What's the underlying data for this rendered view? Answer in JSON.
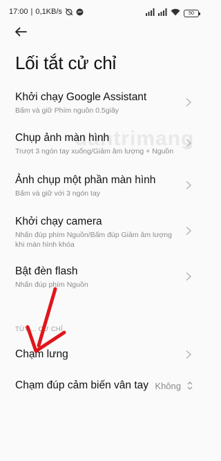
{
  "status_bar": {
    "time": "17:00",
    "network_speed": "0,1KB/s",
    "battery_level": "50",
    "icons": [
      "alarm-off-icon",
      "messenger-icon",
      "signal-icon",
      "signal-icon",
      "wifi-icon",
      "battery-icon"
    ]
  },
  "header": {
    "back_icon": "arrow-left-icon",
    "title": "Lối tắt cử chỉ"
  },
  "items": [
    {
      "title": "Khởi chạy Google Assistant",
      "subtitle": "Bấm và giữ Phím nguồn 0.5giây"
    },
    {
      "title": "Chụp ảnh màn hình",
      "subtitle": "Trượt 3 ngón tay xuống/Giảm âm lượng + Nguồn"
    },
    {
      "title": "Ảnh chụp một phần màn hình",
      "subtitle": "Bấm và giữ với 3 ngón tay"
    },
    {
      "title": "Khởi chạy camera",
      "subtitle_line1": "Nhấn đúp phím Nguồn/Bấm đúp Giảm âm lượng",
      "subtitle_line2": "khi màn hình khóa"
    },
    {
      "title": "Bật đèn flash",
      "subtitle": "Nhấn đúp phím Nguồn"
    }
  ],
  "section": {
    "header": "TÙY ... CỬ CHỈ"
  },
  "extra_items": [
    {
      "title": "Chạm lưng"
    },
    {
      "title": "Chạm đúp cảm biến vân tay",
      "value": "Không"
    }
  ],
  "watermark_text": "uantrimang",
  "colors": {
    "background": "#fafafa",
    "primary_text": "#111111",
    "secondary_text": "#8a8a8a",
    "annotation_arrow": "#e0161b"
  }
}
